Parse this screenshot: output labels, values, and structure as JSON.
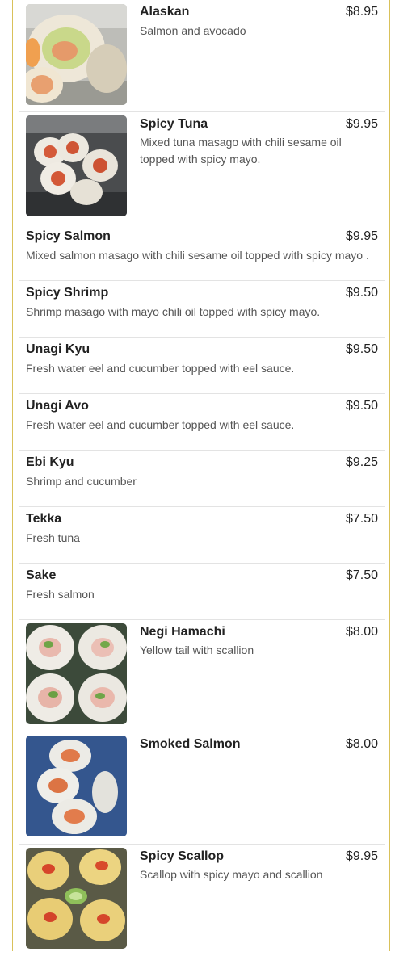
{
  "menu": {
    "items": [
      {
        "name": "Alaskan",
        "price": "$8.95",
        "description": "Salmon and avocado",
        "image": "alaskan-roll-photo"
      },
      {
        "name": "Spicy Tuna",
        "price": "$9.95",
        "description": "Mixed tuna masago with chili sesame oil topped with spicy mayo.",
        "image": "spicy-tuna-roll-photo"
      },
      {
        "name": "Spicy Salmon",
        "price": "$9.95",
        "description": "Mixed salmon masago with chili sesame oil topped with spicy mayo ."
      },
      {
        "name": "Spicy Shrimp",
        "price": "$9.50",
        "description": "Shrimp masago with mayo chili oil topped with spicy mayo."
      },
      {
        "name": "Unagi Kyu",
        "price": "$9.50",
        "description": "Fresh water eel and cucumber topped with eel sauce."
      },
      {
        "name": "Unagi Avo",
        "price": "$9.50",
        "description": "Fresh water eel and cucumber topped with eel sauce."
      },
      {
        "name": "Ebi Kyu",
        "price": "$9.25",
        "description": "Shrimp and cucumber"
      },
      {
        "name": "Tekka",
        "price": "$7.50",
        "description": "Fresh tuna"
      },
      {
        "name": "Sake",
        "price": "$7.50",
        "description": "Fresh salmon"
      },
      {
        "name": "Negi Hamachi",
        "price": "$8.00",
        "description": "Yellow tail with scallion",
        "image": "negi-hamachi-roll-photo"
      },
      {
        "name": "Smoked Salmon",
        "price": "$8.00",
        "image": "smoked-salmon-roll-photo"
      },
      {
        "name": "Spicy Scallop",
        "price": "$9.95",
        "description": "Scallop with spicy mayo and scallion",
        "image": "spicy-scallop-roll-photo"
      }
    ]
  },
  "colors": {
    "border": "#d9c15a",
    "separator": "#e3e3e3",
    "text": "#222222",
    "muted": "#555555"
  }
}
